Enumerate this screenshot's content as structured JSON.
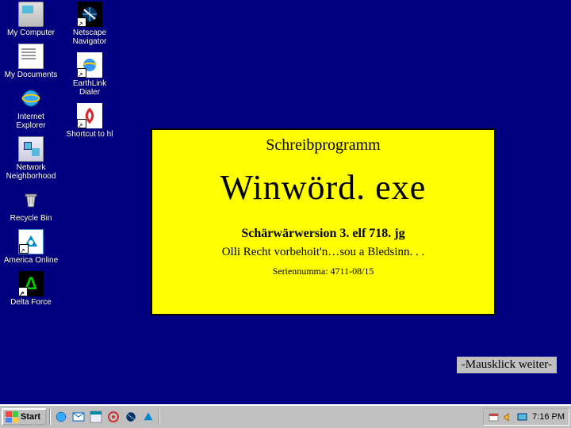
{
  "desktop": {
    "col1": [
      {
        "name": "my-computer",
        "label": "My Computer"
      },
      {
        "name": "my-documents",
        "label": "My Documents"
      },
      {
        "name": "internet-explorer",
        "label": "Internet Explorer"
      },
      {
        "name": "network-neighborhood",
        "label": "Network Neighborhood"
      },
      {
        "name": "recycle-bin",
        "label": "Recycle Bin"
      },
      {
        "name": "america-online",
        "label": "America Online"
      },
      {
        "name": "delta-force",
        "label": "Delta Force"
      }
    ],
    "col2": [
      {
        "name": "netscape-navigator",
        "label": "Netscape Navigator"
      },
      {
        "name": "earthlink-dialer",
        "label": "EarthLink Dialer"
      },
      {
        "name": "shortcut-to-hl",
        "label": "Shortcut to hl"
      }
    ]
  },
  "splash": {
    "title": "Schreibprogramm",
    "app": "Winwörd. exe",
    "version": "Schärwärwersion 3. elf 718. jg",
    "copyright": "Olli Recht vorbehoit'n…sou a Bledsinn. . .",
    "serial": "Seriennumma: 4711-08/15"
  },
  "continue_hint": "-Mausklick weiter-",
  "taskbar": {
    "start": "Start",
    "clock": "7:16 PM"
  }
}
